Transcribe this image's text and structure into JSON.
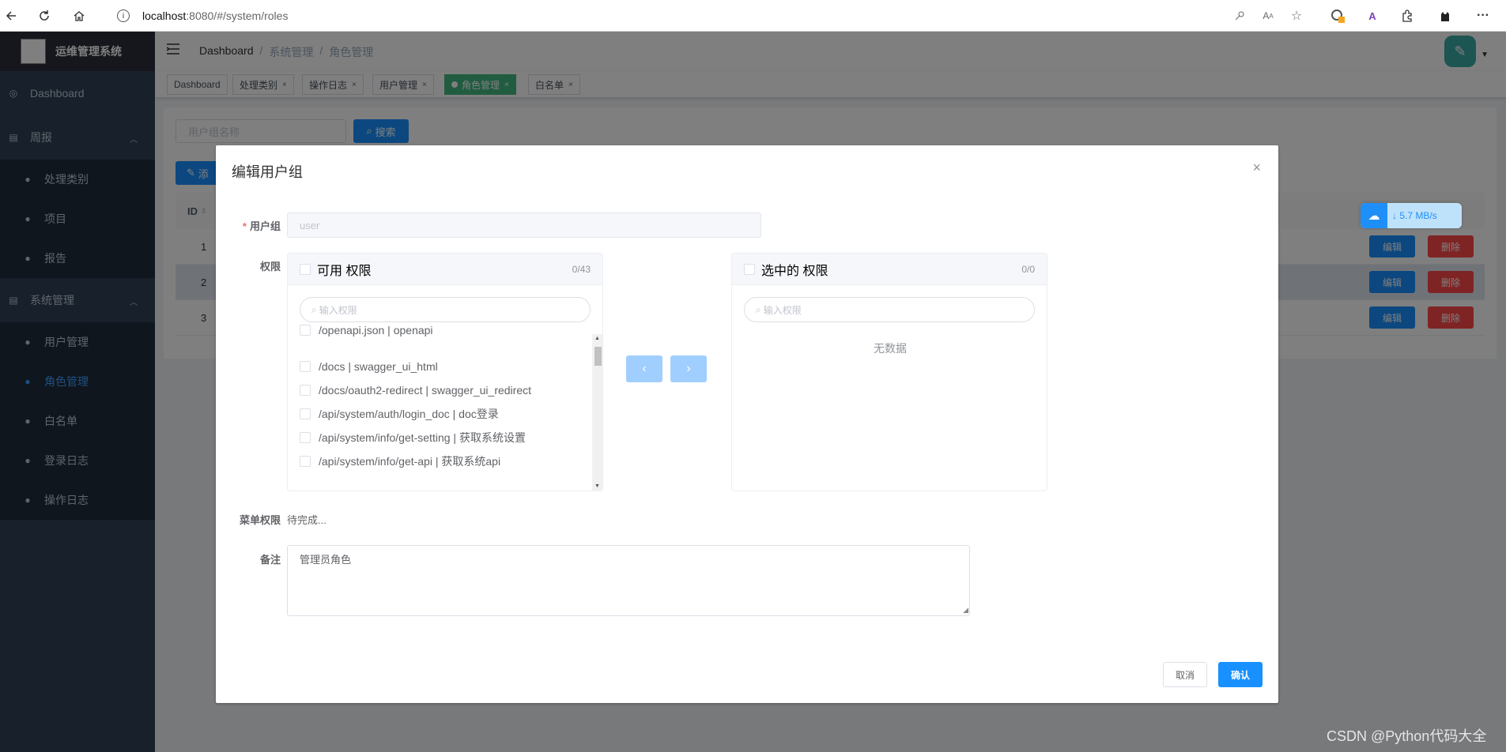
{
  "browser": {
    "url": "localhost:8080/#/system/roles",
    "url_host": "localhost",
    "url_rest": ":8080/#/system/roles"
  },
  "sidebar": {
    "app_title": "运维管理系统",
    "items": [
      {
        "label": "Dashboard"
      },
      {
        "label": "周报",
        "children": [
          {
            "label": "处理类别"
          },
          {
            "label": "项目"
          },
          {
            "label": "报告"
          }
        ]
      },
      {
        "label": "系统管理",
        "children": [
          {
            "label": "用户管理"
          },
          {
            "label": "角色管理"
          },
          {
            "label": "白名单"
          },
          {
            "label": "登录日志"
          },
          {
            "label": "操作日志"
          }
        ]
      }
    ]
  },
  "navbar": {
    "breadcrumb": [
      "Dashboard",
      "/",
      "系统管理",
      "/",
      "角色管理"
    ]
  },
  "tags": [
    {
      "label": "Dashboard"
    },
    {
      "label": "处理类别"
    },
    {
      "label": "操作日志"
    },
    {
      "label": "用户管理"
    },
    {
      "label": "角色管理"
    },
    {
      "label": "白名单"
    }
  ],
  "tag_close": "×",
  "page": {
    "search_placeholder": "用户组名称",
    "search_button": "搜索",
    "add_button": "添",
    "table_header_id": "ID",
    "rows": [
      {
        "id": "1",
        "edit": "编辑",
        "delete": "删除"
      },
      {
        "id": "2",
        "edit": "编辑",
        "delete": "删除"
      },
      {
        "id": "3",
        "edit": "编辑",
        "delete": "删除"
      }
    ]
  },
  "speed_widget": {
    "value": "↓ 5.7 MB/s"
  },
  "dialog": {
    "title": "编辑用户组",
    "close": "×",
    "group_label": "用户组",
    "group_value": "user",
    "perm_label": "权限",
    "left_panel": {
      "title": "可用 权限",
      "count": "0/43",
      "filter_placeholder": "输入权限",
      "items": [
        "/openapi.json | openapi",
        "/docs | swagger_ui_html",
        "/docs/oauth2-redirect | swagger_ui_redirect",
        "/api/system/auth/login_doc | doc登录",
        "/api/system/info/get-setting | 获取系统设置",
        "/api/system/info/get-api | 获取系统api"
      ]
    },
    "right_panel": {
      "title": "选中的 权限",
      "count": "0/0",
      "filter_placeholder": "输入权限",
      "empty": "无数据"
    },
    "move_left": "‹",
    "move_right": "›",
    "menu_label": "菜单权限",
    "menu_value": "待完成...",
    "remark_label": "备注",
    "remark_value": "管理员角色",
    "cancel": "取消",
    "confirm": "确认"
  },
  "watermark": "CSDN @Python代码大全"
}
